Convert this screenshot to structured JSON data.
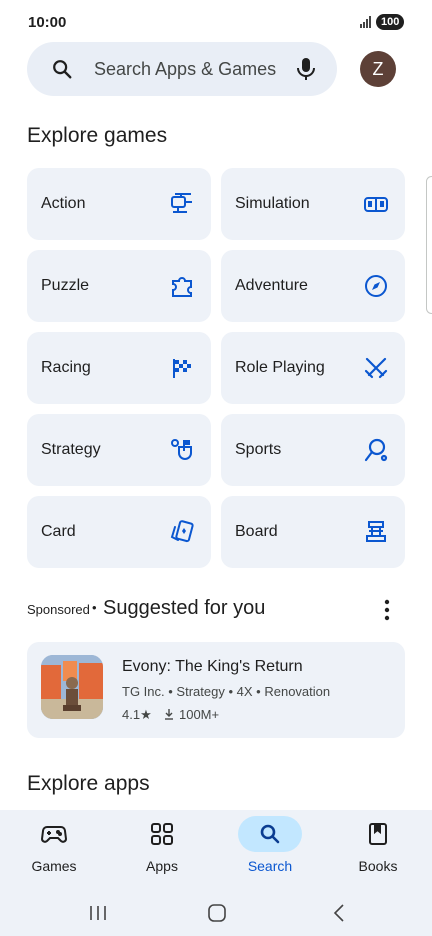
{
  "status_bar": {
    "time": "10:00",
    "battery": "100"
  },
  "search": {
    "placeholder": "Search Apps & Games",
    "avatar_letter": "Z"
  },
  "explore_games": {
    "title": "Explore games",
    "categories": [
      {
        "label": "Action",
        "icon": "helicopter-icon"
      },
      {
        "label": "Simulation",
        "icon": "simulation-icon"
      },
      {
        "label": "Puzzle",
        "icon": "puzzle-icon"
      },
      {
        "label": "Adventure",
        "icon": "compass-icon"
      },
      {
        "label": "Racing",
        "icon": "checkered-flag-icon"
      },
      {
        "label": "Role Playing",
        "icon": "crossed-swords-icon"
      },
      {
        "label": "Strategy",
        "icon": "strategy-icon"
      },
      {
        "label": "Sports",
        "icon": "racket-icon"
      },
      {
        "label": "Card",
        "icon": "cards-icon"
      },
      {
        "label": "Board",
        "icon": "board-game-icon"
      }
    ]
  },
  "suggested": {
    "sponsored": "Sponsored",
    "separator": "•",
    "title": "Suggested for you",
    "app": {
      "name": "Evony: The King's Return",
      "developer": "TG Inc.",
      "tags": [
        "Strategy",
        "4X",
        "Renovation"
      ],
      "rating": "4.1★",
      "downloads": "100M+"
    }
  },
  "explore_apps": {
    "title": "Explore apps"
  },
  "bottom_nav": {
    "items": [
      {
        "label": "Games",
        "icon": "gamepad-icon"
      },
      {
        "label": "Apps",
        "icon": "apps-grid-icon"
      },
      {
        "label": "Search",
        "icon": "search-icon"
      },
      {
        "label": "Books",
        "icon": "book-icon"
      }
    ],
    "active": "Search",
    "accent": "#0b57d0",
    "pill": "#c2e7ff"
  },
  "colors": {
    "icon_blue": "#0b57d0",
    "card_bg": "#eef2f8",
    "search_bg": "#e9eef6"
  }
}
